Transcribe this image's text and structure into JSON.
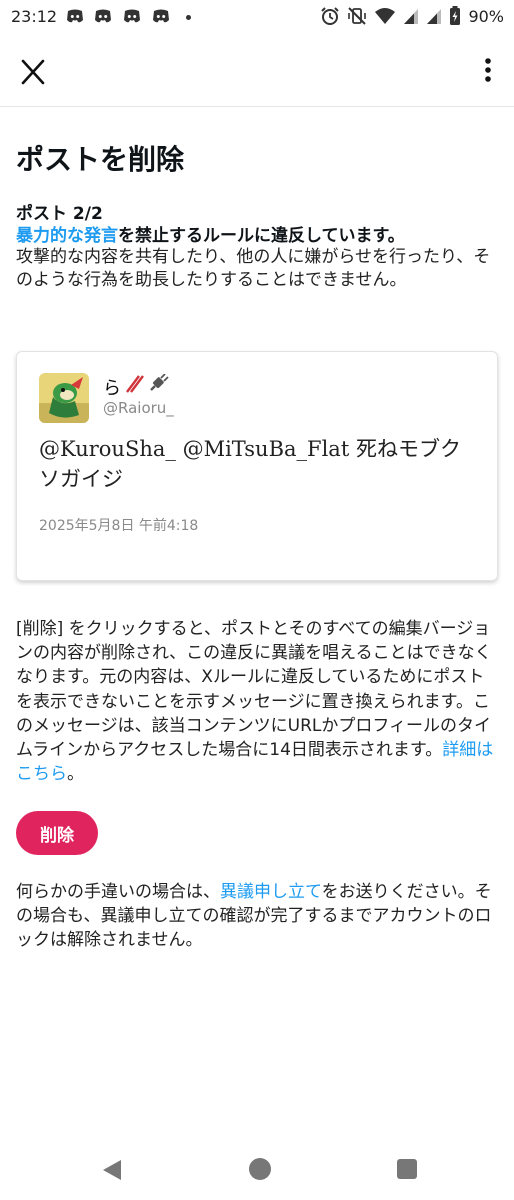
{
  "status_bar": {
    "time": "23:12",
    "notification_icons": [
      "discord-icon",
      "discord-icon",
      "discord-icon",
      "discord-icon"
    ],
    "status_icons": [
      "alarm-icon",
      "vibrate-off-icon",
      "wifi-icon",
      "signal-icon",
      "signal-icon",
      "battery-charging-icon"
    ],
    "battery": "90%"
  },
  "topbar": {
    "app_logo": "X",
    "more_icon": "more-vertical-icon"
  },
  "title": "ポストを削除",
  "post_count": "ポスト 2/2",
  "violation": {
    "link_text": "暴力的な発言",
    "rest": "を禁止するルールに違反しています。",
    "description": "攻撃的な内容を共有したり、他の人に嫌がらせを行ったり、そのような行為を助長したりすることはできません。"
  },
  "post": {
    "display_name": "ら",
    "display_name_emoji": [
      "red-slash-emoji",
      "plug-emoji"
    ],
    "handle": "@Raioru_",
    "text": "@KurouSha_ @MiTsuBa_Flat 死ねモブクソガイジ",
    "date": "2025年5月8日 午前4:18"
  },
  "explanation": {
    "text": "[削除] をクリックすると、ポストとそのすべての編集バージョンの内容が削除され、この違反に異議を唱えることはできなくなります。元の内容は、Xルールに違反しているためにポストを表示できないことを示すメッセージに置き換えられます。このメッセージは、該当コンテンツにURLかプロフィールのタイムラインからアクセスした場合に14日間表示されます。",
    "link_text": "詳細はこちら",
    "tail": "。"
  },
  "delete_button": "削除",
  "appeal": {
    "before": "何らかの手違いの場合は、",
    "link_text": "異議申し立て",
    "after": "をお送りください。その場合も、異議申し立ての確認が完了するまでアカウントのロックは解除されません。"
  },
  "colors": {
    "link": "#1d9bf0",
    "delete_button": "#e0245e",
    "text": "#0f1419"
  },
  "navbar": {
    "icons": [
      "back-icon",
      "home-icon",
      "recents-icon"
    ]
  }
}
